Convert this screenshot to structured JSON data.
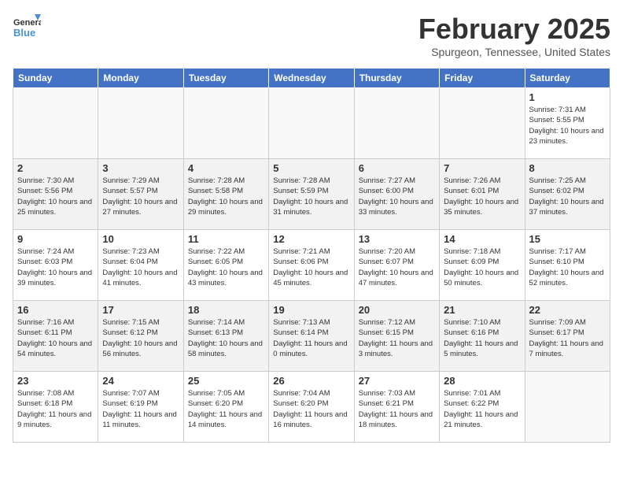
{
  "header": {
    "logo_line1": "General",
    "logo_line2": "Blue",
    "month_year": "February 2025",
    "location": "Spurgeon, Tennessee, United States"
  },
  "days_of_week": [
    "Sunday",
    "Monday",
    "Tuesday",
    "Wednesday",
    "Thursday",
    "Friday",
    "Saturday"
  ],
  "weeks": [
    [
      {
        "day": "",
        "info": ""
      },
      {
        "day": "",
        "info": ""
      },
      {
        "day": "",
        "info": ""
      },
      {
        "day": "",
        "info": ""
      },
      {
        "day": "",
        "info": ""
      },
      {
        "day": "",
        "info": ""
      },
      {
        "day": "1",
        "info": "Sunrise: 7:31 AM\nSunset: 5:55 PM\nDaylight: 10 hours and 23 minutes."
      }
    ],
    [
      {
        "day": "2",
        "info": "Sunrise: 7:30 AM\nSunset: 5:56 PM\nDaylight: 10 hours and 25 minutes."
      },
      {
        "day": "3",
        "info": "Sunrise: 7:29 AM\nSunset: 5:57 PM\nDaylight: 10 hours and 27 minutes."
      },
      {
        "day": "4",
        "info": "Sunrise: 7:28 AM\nSunset: 5:58 PM\nDaylight: 10 hours and 29 minutes."
      },
      {
        "day": "5",
        "info": "Sunrise: 7:28 AM\nSunset: 5:59 PM\nDaylight: 10 hours and 31 minutes."
      },
      {
        "day": "6",
        "info": "Sunrise: 7:27 AM\nSunset: 6:00 PM\nDaylight: 10 hours and 33 minutes."
      },
      {
        "day": "7",
        "info": "Sunrise: 7:26 AM\nSunset: 6:01 PM\nDaylight: 10 hours and 35 minutes."
      },
      {
        "day": "8",
        "info": "Sunrise: 7:25 AM\nSunset: 6:02 PM\nDaylight: 10 hours and 37 minutes."
      }
    ],
    [
      {
        "day": "9",
        "info": "Sunrise: 7:24 AM\nSunset: 6:03 PM\nDaylight: 10 hours and 39 minutes."
      },
      {
        "day": "10",
        "info": "Sunrise: 7:23 AM\nSunset: 6:04 PM\nDaylight: 10 hours and 41 minutes."
      },
      {
        "day": "11",
        "info": "Sunrise: 7:22 AM\nSunset: 6:05 PM\nDaylight: 10 hours and 43 minutes."
      },
      {
        "day": "12",
        "info": "Sunrise: 7:21 AM\nSunset: 6:06 PM\nDaylight: 10 hours and 45 minutes."
      },
      {
        "day": "13",
        "info": "Sunrise: 7:20 AM\nSunset: 6:07 PM\nDaylight: 10 hours and 47 minutes."
      },
      {
        "day": "14",
        "info": "Sunrise: 7:18 AM\nSunset: 6:09 PM\nDaylight: 10 hours and 50 minutes."
      },
      {
        "day": "15",
        "info": "Sunrise: 7:17 AM\nSunset: 6:10 PM\nDaylight: 10 hours and 52 minutes."
      }
    ],
    [
      {
        "day": "16",
        "info": "Sunrise: 7:16 AM\nSunset: 6:11 PM\nDaylight: 10 hours and 54 minutes."
      },
      {
        "day": "17",
        "info": "Sunrise: 7:15 AM\nSunset: 6:12 PM\nDaylight: 10 hours and 56 minutes."
      },
      {
        "day": "18",
        "info": "Sunrise: 7:14 AM\nSunset: 6:13 PM\nDaylight: 10 hours and 58 minutes."
      },
      {
        "day": "19",
        "info": "Sunrise: 7:13 AM\nSunset: 6:14 PM\nDaylight: 11 hours and 0 minutes."
      },
      {
        "day": "20",
        "info": "Sunrise: 7:12 AM\nSunset: 6:15 PM\nDaylight: 11 hours and 3 minutes."
      },
      {
        "day": "21",
        "info": "Sunrise: 7:10 AM\nSunset: 6:16 PM\nDaylight: 11 hours and 5 minutes."
      },
      {
        "day": "22",
        "info": "Sunrise: 7:09 AM\nSunset: 6:17 PM\nDaylight: 11 hours and 7 minutes."
      }
    ],
    [
      {
        "day": "23",
        "info": "Sunrise: 7:08 AM\nSunset: 6:18 PM\nDaylight: 11 hours and 9 minutes."
      },
      {
        "day": "24",
        "info": "Sunrise: 7:07 AM\nSunset: 6:19 PM\nDaylight: 11 hours and 11 minutes."
      },
      {
        "day": "25",
        "info": "Sunrise: 7:05 AM\nSunset: 6:20 PM\nDaylight: 11 hours and 14 minutes."
      },
      {
        "day": "26",
        "info": "Sunrise: 7:04 AM\nSunset: 6:20 PM\nDaylight: 11 hours and 16 minutes."
      },
      {
        "day": "27",
        "info": "Sunrise: 7:03 AM\nSunset: 6:21 PM\nDaylight: 11 hours and 18 minutes."
      },
      {
        "day": "28",
        "info": "Sunrise: 7:01 AM\nSunset: 6:22 PM\nDaylight: 11 hours and 21 minutes."
      },
      {
        "day": "",
        "info": ""
      }
    ]
  ]
}
